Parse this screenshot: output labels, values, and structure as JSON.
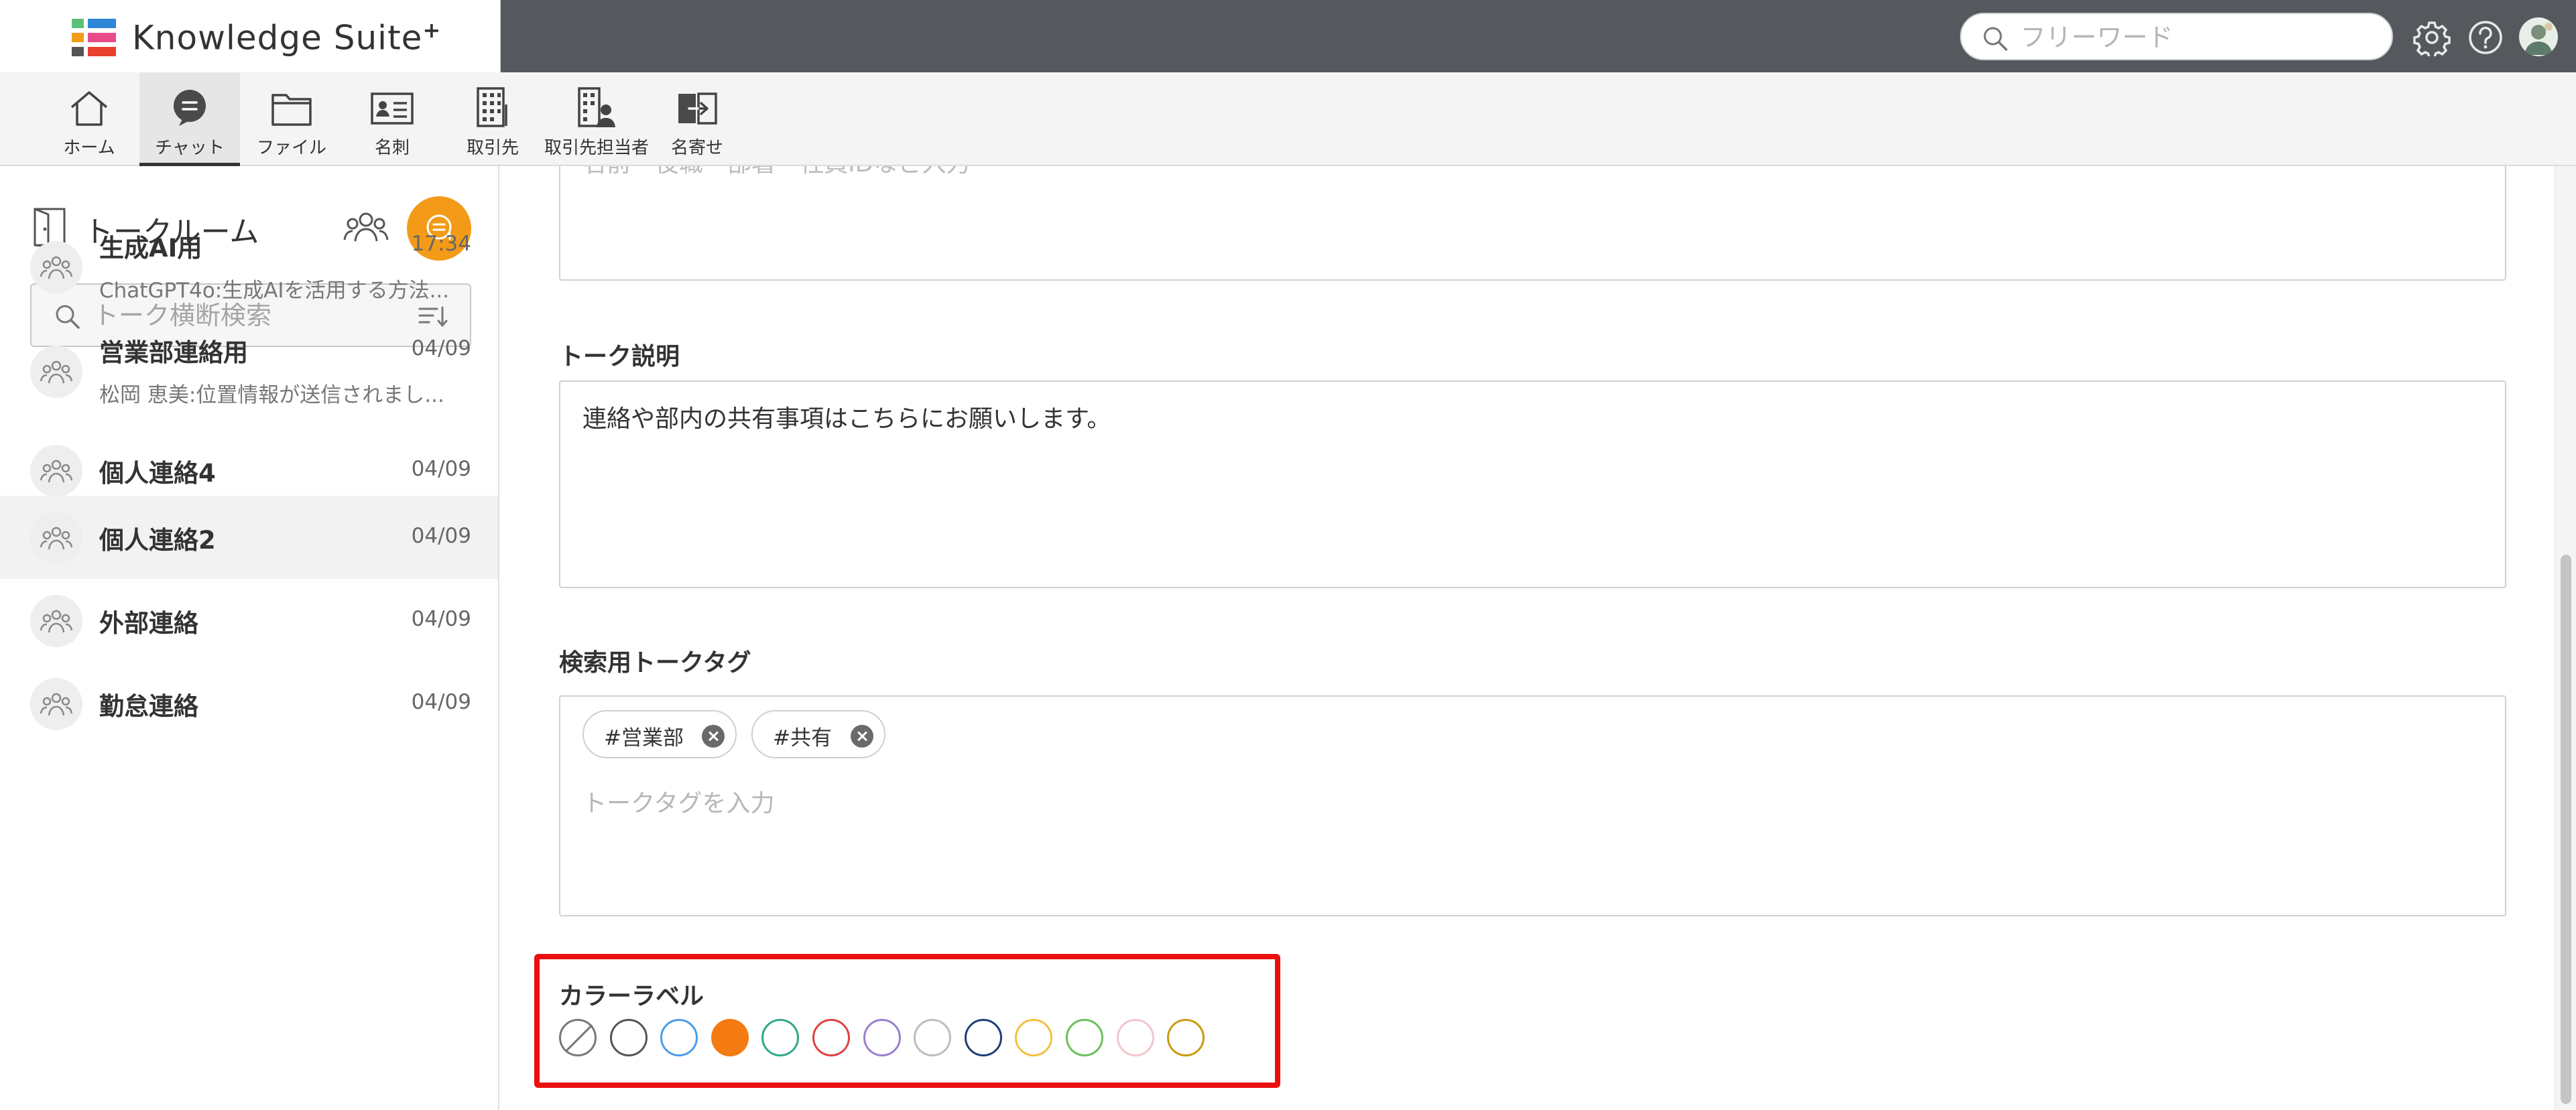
{
  "app": {
    "name": "Knowledge Suite",
    "name_suffix": "+"
  },
  "header": {
    "search_placeholder": "フリーワード",
    "icons": [
      "gear-icon",
      "help-icon",
      "user-avatar"
    ]
  },
  "nav": {
    "items": [
      {
        "label": "ホーム",
        "icon": "home-icon"
      },
      {
        "label": "チャット",
        "icon": "chat-icon",
        "active": true
      },
      {
        "label": "ファイル",
        "icon": "folder-icon"
      },
      {
        "label": "名刺",
        "icon": "business-card-icon"
      },
      {
        "label": "取引先",
        "icon": "building-icon"
      },
      {
        "label": "取引先担当者",
        "icon": "building-person-icon"
      },
      {
        "label": "名寄せ",
        "icon": "merge-icon"
      }
    ]
  },
  "sidebar": {
    "title": "トークルーム",
    "search_placeholder": "トーク横断検索",
    "rooms": [
      {
        "name": "生成AI用",
        "time": "17:34",
        "preview": "ChatGPT4o:生成AIを活用する方法..."
      },
      {
        "name": "営業部連絡用",
        "time": "04/09",
        "preview": "松岡 恵美:位置情報が送信されまし..."
      },
      {
        "name": "個人連絡4",
        "time": "04/09",
        "preview": ""
      },
      {
        "name": "個人連絡2",
        "time": "04/09",
        "preview": "",
        "selected": true
      },
      {
        "name": "外部連絡",
        "time": "04/09",
        "preview": ""
      },
      {
        "name": "勤怠連絡",
        "time": "04/09",
        "preview": ""
      }
    ]
  },
  "main": {
    "members_placeholder": "名前・役職・部署・社員IDなど入力",
    "description": {
      "label": "トーク説明",
      "value": "連絡や部内の共有事項はこちらにお願いします。"
    },
    "tags": {
      "label": "検索用トークタグ",
      "items": [
        "#営業部",
        "#共有"
      ],
      "placeholder": "トークタグを入力"
    },
    "color_label": {
      "label": "カラーラベル",
      "selected_index": 3,
      "swatches": [
        "none",
        "#555555",
        "#4a9be8",
        "#f47a12",
        "#2fa88a",
        "#e04040",
        "#9a7fd0",
        "#bdbdbd",
        "#1f3e78",
        "#f2c040",
        "#6abf5a",
        "#f2c6cc",
        "#c99a10"
      ]
    }
  }
}
